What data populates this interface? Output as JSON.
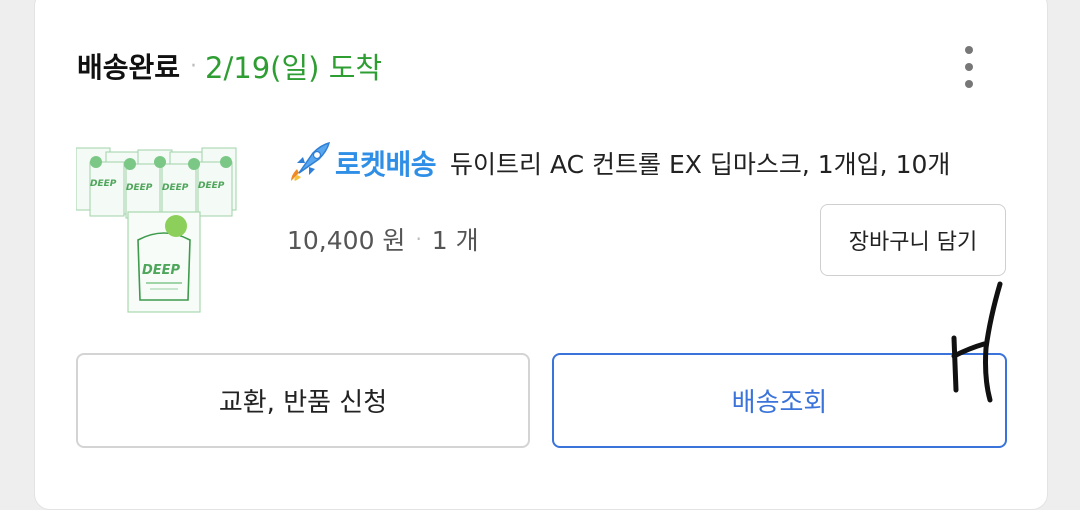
{
  "order": {
    "status": "배송완료",
    "separator": "·",
    "arrival": "2/19(일) 도착"
  },
  "menu": {
    "icon": "kebab-menu-icon"
  },
  "product": {
    "thumbnail_icon": "product-thumbnail",
    "delivery_badge_icon": "rocket-icon",
    "delivery_badge": "로켓배송",
    "name": "듀이트리 AC 컨트롤 EX 딥마스크, 1개입, 10개",
    "price": "10,400 원",
    "separator": "·",
    "quantity": "1 개"
  },
  "buttons": {
    "add_to_cart": "장바구니 담기",
    "exchange_return": "교환, 반품 신청",
    "track_delivery": "배송조회"
  },
  "colors": {
    "arrival_green": "#2e9e33",
    "rocket_blue": "#2f8fe6",
    "track_blue": "#3a73d9"
  }
}
